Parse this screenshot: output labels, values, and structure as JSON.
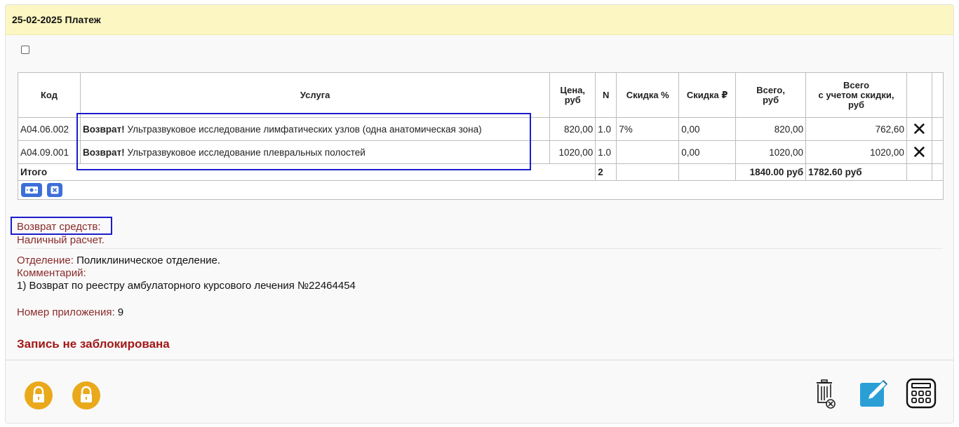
{
  "header": {
    "title": "25-02-2025 Платеж"
  },
  "table": {
    "columns": {
      "code": "Код",
      "service": "Услуга",
      "price_l1": "Цена,",
      "price_l2": "руб",
      "n": "N",
      "discount_pct": "Скидка %",
      "discount_rub": "Скидка ₽",
      "total_l1": "Всего,",
      "total_l2": "руб",
      "total_disc_l1": "Всего",
      "total_disc_l2": "с учетом скидки,",
      "total_disc_l3": "руб"
    },
    "rows": [
      {
        "code": "A04.06.002",
        "tag": "Возврат!",
        "service": "Ультразвуковое исследование лимфатических узлов (одна анатомическая зона)",
        "price": "820,00",
        "n": "1.0",
        "discount_pct": "7%",
        "discount_rub": "0,00",
        "total": "820,00",
        "total_disc": "762,60",
        "remove": "✕"
      },
      {
        "code": "A04.09.001",
        "tag": "Возврат!",
        "service": "Ультразвуковое исследование плевральных полостей",
        "price": "1020,00",
        "n": "1.0",
        "discount_pct": "",
        "discount_rub": "0,00",
        "total": "1020,00",
        "total_disc": "1020,00",
        "remove": "✕"
      }
    ],
    "totals": {
      "label": "Итого",
      "n": "2",
      "total": "1840.00 руб",
      "total_disc": "1782.60 руб"
    }
  },
  "refund": {
    "label": "Возврат средств:",
    "method": "Наличный расчет."
  },
  "department": {
    "label": "Отделение:",
    "value": "Поликлиническое отделение."
  },
  "comment": {
    "label": "Комментарий:",
    "text": "1) Возврат по реестру амбулаторного курсового лечения №22464454"
  },
  "appendix": {
    "label": "Номер приложения:",
    "value": "9"
  },
  "status": "Запись не заблокирована",
  "colors": {
    "header_bg": "#fcf6c2",
    "label": "#8a2a2a",
    "status": "#a11818",
    "lock": "#e9a91b",
    "button_blue": "#3d6fd9",
    "edit_blue": "#2a9fd6",
    "highlight": "#1c1ccc"
  },
  "icons": {
    "cash": "cash-icon",
    "clear": "clear-icon",
    "lock": "lock-icon",
    "delete": "trash-icon",
    "edit": "edit-icon",
    "calculator": "calculator-icon"
  }
}
